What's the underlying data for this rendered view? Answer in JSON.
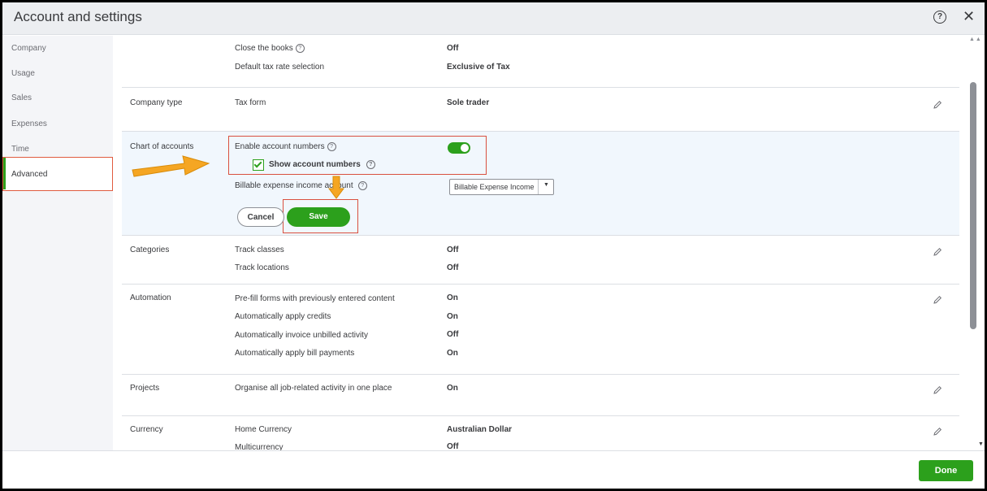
{
  "window": {
    "title": "Account and settings",
    "help_icon": "question-circle-icon",
    "close_glyph": "✕"
  },
  "sidebar": {
    "items": [
      {
        "label": "Company"
      },
      {
        "label": "Usage"
      },
      {
        "label": "Sales"
      },
      {
        "label": "Expenses"
      },
      {
        "label": "Time"
      },
      {
        "label": "Advanced",
        "active": true
      }
    ]
  },
  "settings": {
    "accounting": {
      "rows": [
        {
          "label": "Close the books",
          "help": true,
          "value": "Off"
        },
        {
          "label": "Default tax rate selection",
          "value": "Exclusive of Tax"
        }
      ]
    },
    "company_type": {
      "section": "Company type",
      "rows": [
        {
          "label": "Tax form",
          "value": "Sole trader"
        }
      ]
    },
    "chart_of_accounts": {
      "section": "Chart of accounts",
      "enable_label": "Enable account numbers",
      "enable_on": true,
      "show_label": "Show account numbers",
      "show_checked": true,
      "billable_label": "Billable expense income account",
      "billable_value": "Billable Expense Income",
      "cancel_label": "Cancel",
      "save_label": "Save"
    },
    "categories": {
      "section": "Categories",
      "rows": [
        {
          "label": "Track classes",
          "value": "Off"
        },
        {
          "label": "Track locations",
          "value": "Off"
        }
      ]
    },
    "automation": {
      "section": "Automation",
      "rows": [
        {
          "label": "Pre-fill forms with previously entered content",
          "value": "On"
        },
        {
          "label": "Automatically apply credits",
          "value": "On"
        },
        {
          "label": "Automatically invoice unbilled activity",
          "value": "Off"
        },
        {
          "label": "Automatically apply bill payments",
          "value": "On"
        }
      ]
    },
    "projects": {
      "section": "Projects",
      "rows": [
        {
          "label": "Organise all job-related activity in one place",
          "value": "On"
        }
      ]
    },
    "currency": {
      "section": "Currency",
      "rows": [
        {
          "label": "Home Currency",
          "value": "Australian Dollar"
        },
        {
          "label": "Multicurrency",
          "value": "Off"
        }
      ]
    }
  },
  "footer": {
    "done_label": "Done"
  },
  "colors": {
    "accent_green": "#2ca01c",
    "highlight_red": "#d9503f",
    "arrow_orange": "#f5a623",
    "edit_bg": "#f1f7fd"
  }
}
